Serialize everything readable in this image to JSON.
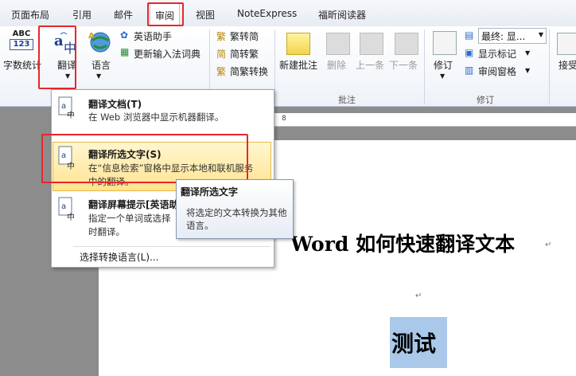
{
  "tabs": [
    {
      "label": "页面布局"
    },
    {
      "label": "引用"
    },
    {
      "label": "邮件"
    },
    {
      "label": "审阅"
    },
    {
      "label": "视图"
    },
    {
      "label": "NoteExpress"
    },
    {
      "label": "福昕阅读器"
    }
  ],
  "ribbon": {
    "word_count": {
      "icon_text_top": "ABC",
      "icon_text_bottom": "123",
      "label": "字数统计"
    },
    "translate": {
      "label": "翻译"
    },
    "language": {
      "label": "语言"
    },
    "english_assistant": "英语助手",
    "update_ime": "更新输入法词典",
    "trad_to_simp": "繁转简",
    "simp_to_trad": "简转繁",
    "trad_simp_convert": "简繁转换",
    "new_comment": "新建批注",
    "delete": "删除",
    "previous": "上一条",
    "next": "下一条",
    "group_comments": "批注",
    "track_changes": "修订",
    "final_show": "最终: 显...",
    "show_markup": "显示标记",
    "review_pane": "审阅窗格",
    "group_tracking": "修订",
    "accept": "接受"
  },
  "menu": {
    "items": [
      {
        "title": "翻译文档(T)",
        "desc": "在 Web 浏览器中显示机器翻译。"
      },
      {
        "title": "翻译所选文字(S)",
        "desc": "在“信息检索”窗格中显示本地和联机服务中的翻译。"
      },
      {
        "title": "翻译屏幕提示[英语助",
        "desc": "指定一个单词或选择时翻译。"
      }
    ],
    "choose_language": "选择转换语言(L)..."
  },
  "tooltip": {
    "title": "翻译所选文字",
    "body": "将选定的文本转换为其他语言。"
  },
  "document": {
    "title": "Word 如何快速翻译文本",
    "selected": "测试"
  },
  "ruler": {
    "mark": "8"
  },
  "colors": {
    "highlight_red": "#e8262b",
    "selection": "#a9c8ea",
    "menu_hover": "#ffe38f"
  }
}
